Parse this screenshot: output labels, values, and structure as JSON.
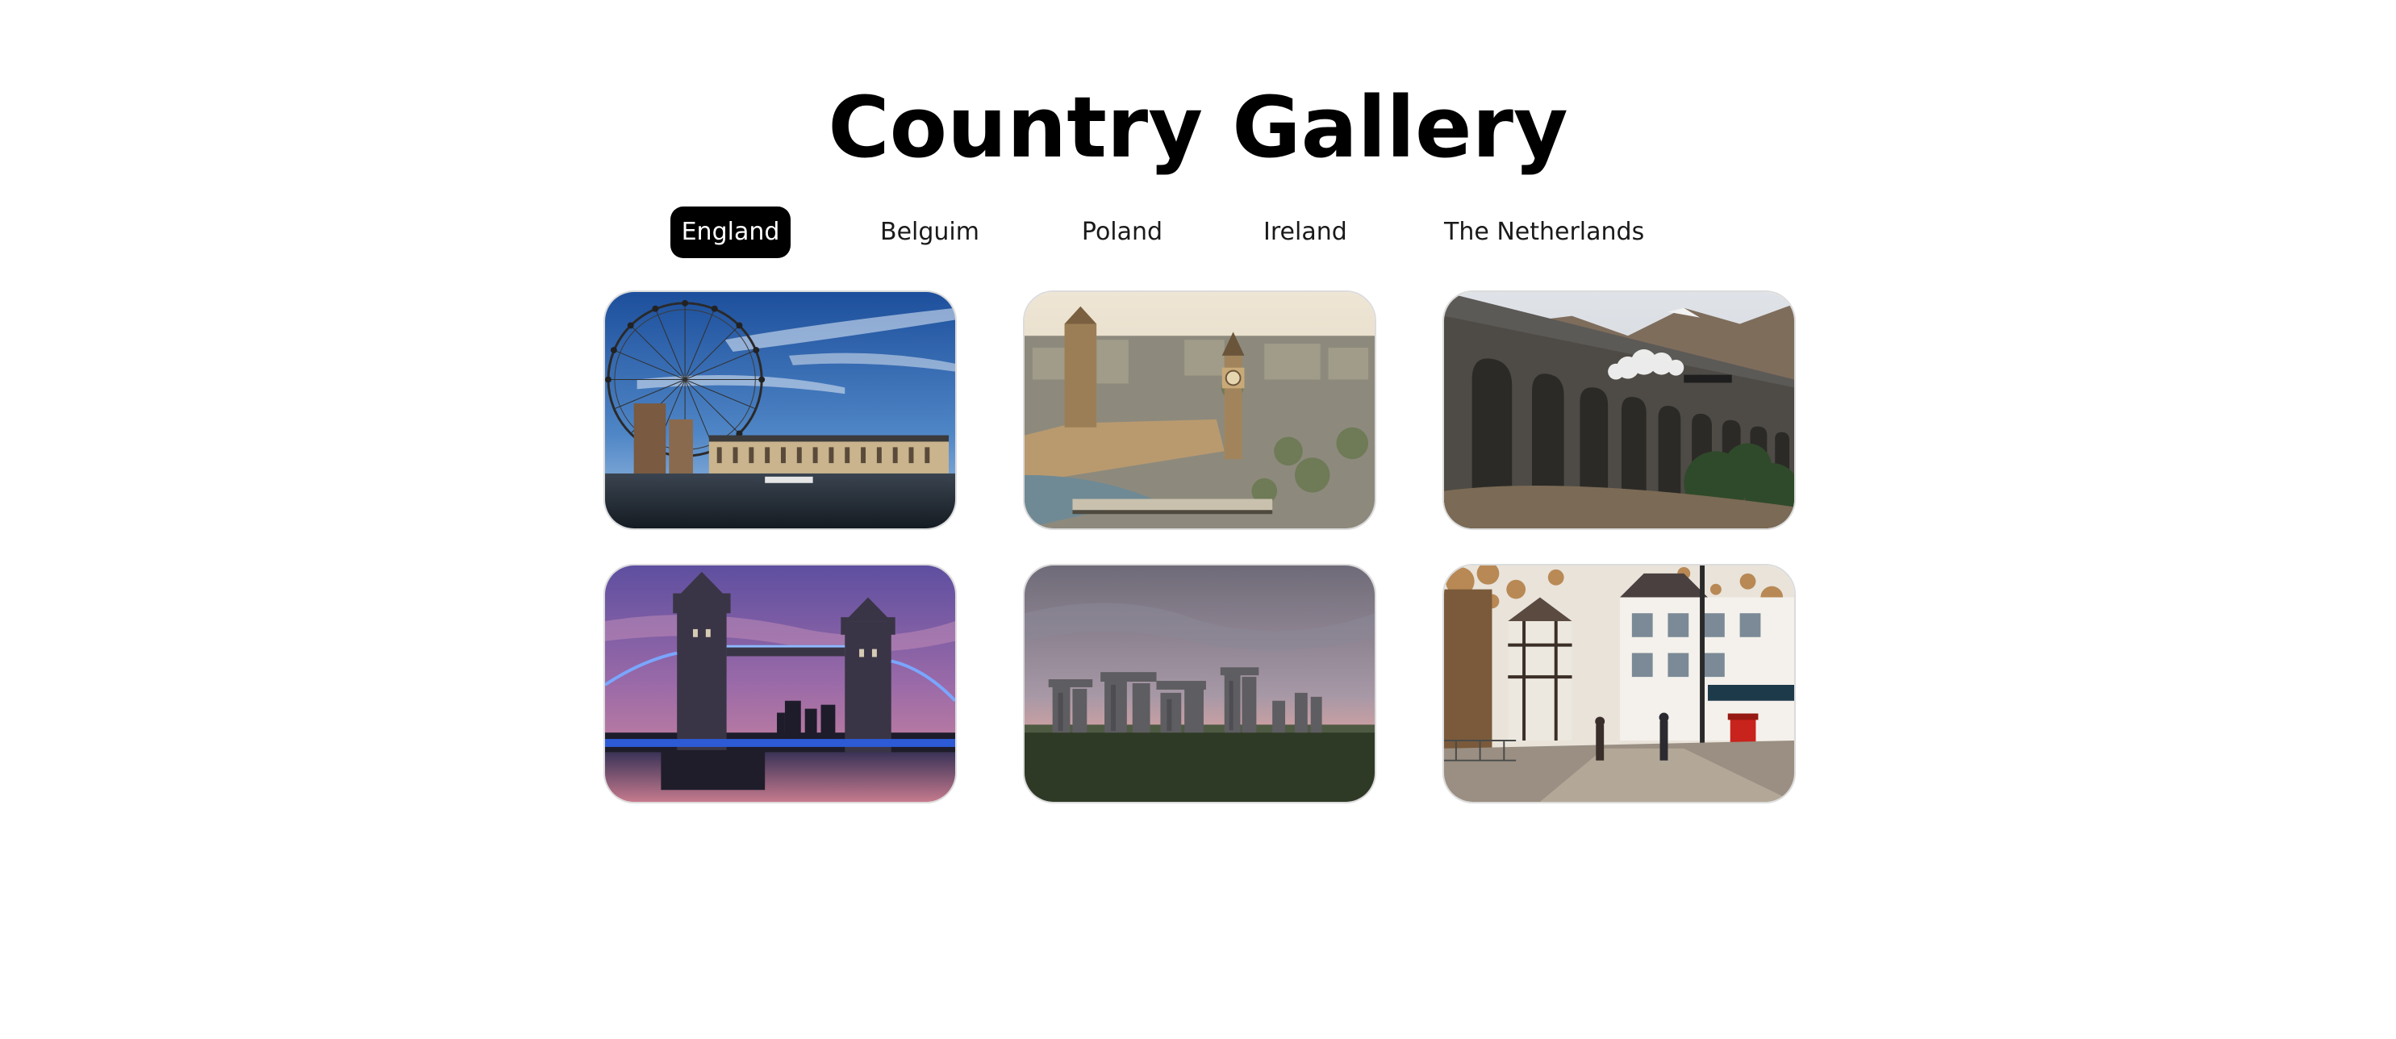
{
  "title": "Country Gallery",
  "tabs": [
    {
      "label": "England",
      "active": true
    },
    {
      "label": "Belguim",
      "active": false
    },
    {
      "label": "Poland",
      "active": false
    },
    {
      "label": "Ireland",
      "active": false
    },
    {
      "label": "The Netherlands",
      "active": false
    }
  ],
  "gallery": {
    "country": "England",
    "photos": [
      {
        "subject": "London Eye and County Hall on the Thames"
      },
      {
        "subject": "Palace of Westminster and Big Ben aerial view"
      },
      {
        "subject": "Stone railway viaduct with steam train"
      },
      {
        "subject": "Tower Bridge at dusk"
      },
      {
        "subject": "Stonehenge under a cloudy sky"
      },
      {
        "subject": "Town street with half-timbered buildings and red post box"
      }
    ]
  },
  "colors": {
    "active_tab_bg": "#000000",
    "active_tab_text": "#ffffff",
    "tab_text": "#1a1a1a",
    "background": "#ffffff"
  }
}
